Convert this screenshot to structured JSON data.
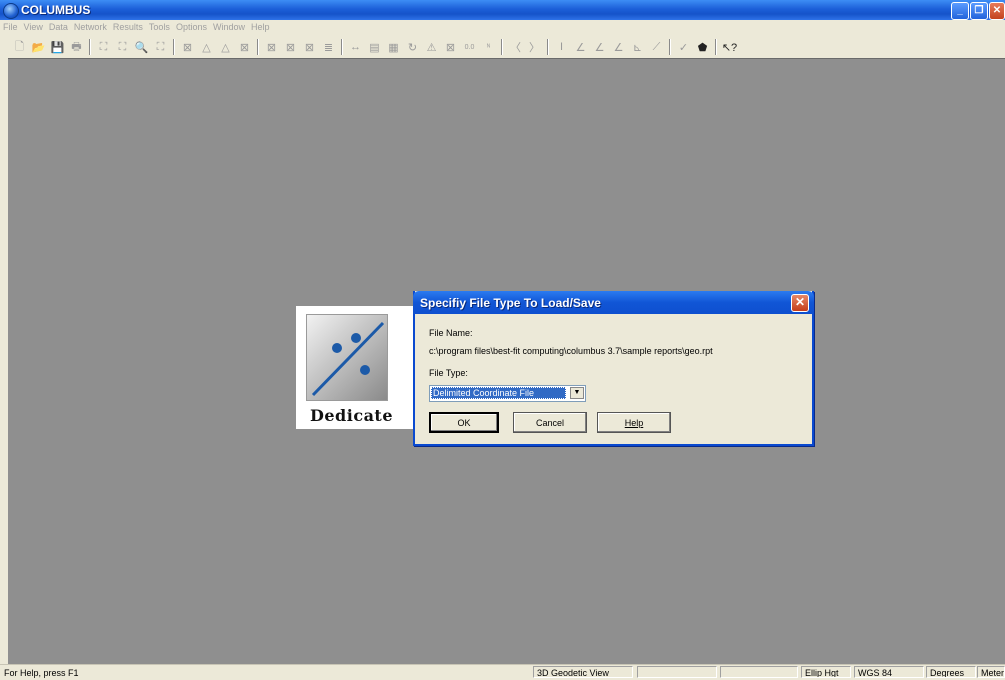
{
  "window": {
    "title": "COLUMBUS",
    "min_label": "_",
    "restore_label": "❐",
    "close_label": "✕"
  },
  "menu": [
    "File",
    "View",
    "Data",
    "Network",
    "Results",
    "Tools",
    "Options",
    "Window",
    "Help"
  ],
  "toolbar_icons": [
    {
      "name": "new-icon",
      "glyph": "🗋"
    },
    {
      "name": "open-icon",
      "glyph": "📂"
    },
    {
      "name": "save-icon",
      "glyph": "💾"
    },
    {
      "name": "print-icon",
      "glyph": "🖶"
    },
    {
      "name": "sep"
    },
    {
      "name": "zoom-in-icon",
      "glyph": "⛶"
    },
    {
      "name": "zoom-out-icon",
      "glyph": "⛶"
    },
    {
      "name": "magnify-icon",
      "glyph": "🔍"
    },
    {
      "name": "zoom-window-icon",
      "glyph": "⛶"
    },
    {
      "name": "sep"
    },
    {
      "name": "station-icon",
      "glyph": "⊠"
    },
    {
      "name": "triangle-icon",
      "glyph": "△"
    },
    {
      "name": "triangle-dashed-icon",
      "glyph": "△"
    },
    {
      "name": "box-x-icon",
      "glyph": "⊠"
    },
    {
      "name": "sep"
    },
    {
      "name": "network-icon",
      "glyph": "⊠"
    },
    {
      "name": "network2-icon",
      "glyph": "⊠"
    },
    {
      "name": "network3-icon",
      "glyph": "⊠"
    },
    {
      "name": "list-icon",
      "glyph": "≣"
    },
    {
      "name": "sep"
    },
    {
      "name": "arrows-icon",
      "glyph": "↔"
    },
    {
      "name": "report-icon",
      "glyph": "▤"
    },
    {
      "name": "table-icon",
      "glyph": "▦"
    },
    {
      "name": "sigma-icon",
      "glyph": "↻"
    },
    {
      "name": "tri-warn-icon",
      "glyph": "⚠"
    },
    {
      "name": "box-icon",
      "glyph": "⊠"
    },
    {
      "name": "decimals-icon",
      "glyph": "0.0"
    },
    {
      "name": "nft-icon",
      "glyph": "ᴺ"
    },
    {
      "name": "sep"
    },
    {
      "name": "prev-icon",
      "glyph": "〈"
    },
    {
      "name": "next-icon",
      "glyph": "〉"
    },
    {
      "name": "sep"
    },
    {
      "name": "vertical-icon",
      "glyph": "I"
    },
    {
      "name": "angle-icon",
      "glyph": "∠"
    },
    {
      "name": "angle2-icon",
      "glyph": "∠"
    },
    {
      "name": "angle3-icon",
      "glyph": "∠"
    },
    {
      "name": "angle4-icon",
      "glyph": "⊾"
    },
    {
      "name": "angle5-icon",
      "glyph": "⟋"
    },
    {
      "name": "sep"
    },
    {
      "name": "check-icon",
      "glyph": "✓"
    },
    {
      "name": "shape-icon",
      "glyph": "⬟",
      "dark": true
    },
    {
      "name": "sep"
    },
    {
      "name": "help-pointer-icon",
      "glyph": "↖?",
      "dark": true
    }
  ],
  "splash": {
    "text": "Dedicate"
  },
  "dialog": {
    "title": "Specifiy File Type To Load/Save",
    "file_name_label": "File Name:",
    "file_name_value": "c:\\program files\\best-fit computing\\columbus 3.7\\sample reports\\geo.rpt",
    "file_type_label": "File Type:",
    "file_type_value": "Delimited Coordinate File",
    "ok_label": "OK",
    "cancel_label": "Cancel",
    "help_label": "Help"
  },
  "statusbar": {
    "help": "For Help, press F1",
    "view": "3D Geodetic View",
    "pane1": "",
    "pane2": "",
    "height": "Ellip Hgt",
    "datum": "WGS 84",
    "angle_units": "Degrees",
    "distance_units": "Meter"
  }
}
